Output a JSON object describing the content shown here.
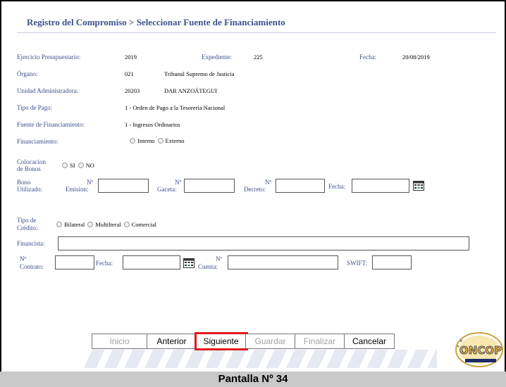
{
  "title": "Registro del Compromiso > Seleccionar Fuente de Financiamiento",
  "ejercicio": {
    "label": "Ejercicio Presupuestario:",
    "value": "2019"
  },
  "expediente": {
    "label": "Expediente:",
    "value": "225"
  },
  "fecha_top": {
    "label": "Fecha:",
    "value": "20/08/2019"
  },
  "organo": {
    "label": "Órgano:",
    "code": "021",
    "name": "Tribunal Supremo de Justicia"
  },
  "unidad": {
    "label": "Unidad Administradora:",
    "code": "20203",
    "name": "DAR ANZOÁTEGUI"
  },
  "tipo_pago": {
    "label": "Tipo de Pago:",
    "value": "1 - Orden de Pago a la Tesoreria Nacional"
  },
  "fuente": {
    "label": "Fuente de Financiamiento:",
    "value": "1 - Ingresos Ordinarios"
  },
  "financiamiento": {
    "label": "Financiamiento:",
    "options": [
      "Interno",
      "Externo"
    ]
  },
  "colocacion": {
    "label_1": "Colocacion",
    "label_2": "de Bonos",
    "options": [
      "SI",
      "NO"
    ]
  },
  "bono": {
    "label_1": "Bono",
    "label_2": "Utilizado:",
    "emision_1": "Nº",
    "emision_2": "Emision:",
    "gaceta_1": "Nº",
    "gaceta_2": "Gaceta:",
    "decreto_1": "Nº",
    "decreto_2": "Decreto:",
    "fecha": "Fecha:"
  },
  "tipo_credito": {
    "label_1": "Tipo de",
    "label_2": "Crédito:",
    "options": [
      "Bilateral",
      "Multilteral",
      "Comercial"
    ]
  },
  "financista": {
    "label": "Financista:"
  },
  "contrato": {
    "label_1": "Nº",
    "label_2": "Contrato:",
    "fecha": "Fecha:",
    "cuenta_1": "Nº",
    "cuenta_2": "Cuenta:",
    "swift": "SWIFT:"
  },
  "buttons": {
    "inicio": "Inicio",
    "anterior": "Anterior",
    "siguiente": "Siguiente",
    "guardar": "Guardar",
    "finalizar": "Finalizar",
    "cancelar": "Cancelar"
  },
  "logo_text": "ONCOP",
  "caption": "Pantalla Nº 34",
  "colors": {
    "label": "#3f4f8c",
    "highlight": "#e0191b",
    "logo": "#f2b632"
  }
}
